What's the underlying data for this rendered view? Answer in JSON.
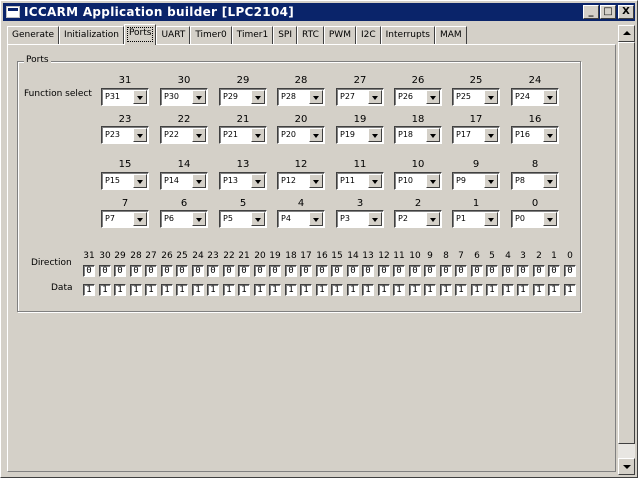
{
  "window": {
    "title": "ICCARM Application builder [LPC2104]",
    "controls": {
      "minimize": "_",
      "maximize": "□",
      "close": "X"
    }
  },
  "tabs": [
    "Generate",
    "Initialization",
    "Ports",
    "UART",
    "Timer0",
    "Timer1",
    "SPI",
    "RTC",
    "PWM",
    "I2C",
    "Interrupts",
    "MAM"
  ],
  "active_tab": "Ports",
  "ports_group": {
    "caption": "Ports",
    "function_select_label": "Function select",
    "rows": [
      {
        "ports": [
          "31",
          "30",
          "29",
          "28",
          "27",
          "26",
          "25",
          "24"
        ],
        "values": [
          "P31",
          "P30",
          "P29",
          "P28",
          "P27",
          "P26",
          "P25",
          "P24"
        ]
      },
      {
        "ports": [
          "23",
          "22",
          "21",
          "20",
          "19",
          "18",
          "17",
          "16"
        ],
        "values": [
          "P23",
          "P22",
          "P21",
          "P20",
          "P19",
          "P18",
          "P17",
          "P16"
        ]
      },
      {
        "ports": [
          "15",
          "14",
          "13",
          "12",
          "11",
          "10",
          "9",
          "8"
        ],
        "values": [
          "P15",
          "P14",
          "P13",
          "P12",
          "P11",
          "P10",
          "P9",
          "P8"
        ]
      },
      {
        "ports": [
          "7",
          "6",
          "5",
          "4",
          "3",
          "2",
          "1",
          "0"
        ],
        "values": [
          "P7",
          "P6",
          "P5",
          "P4",
          "P3",
          "P2",
          "P1",
          "P0"
        ]
      }
    ],
    "direction_label": "Direction",
    "data_label": "Data",
    "bit_numbers": [
      "31",
      "30",
      "29",
      "28",
      "27",
      "26",
      "25",
      "24",
      "23",
      "22",
      "21",
      "20",
      "19",
      "18",
      "17",
      "16",
      "15",
      "14",
      "13",
      "12",
      "11",
      "10",
      "9",
      "8",
      "7",
      "6",
      "5",
      "4",
      "3",
      "2",
      "1",
      "0"
    ],
    "direction_values": [
      "0",
      "0",
      "0",
      "0",
      "0",
      "0",
      "0",
      "0",
      "0",
      "0",
      "0",
      "0",
      "0",
      "0",
      "0",
      "0",
      "0",
      "0",
      "0",
      "0",
      "0",
      "0",
      "0",
      "0",
      "0",
      "0",
      "0",
      "0",
      "0",
      "0",
      "0",
      "0"
    ],
    "data_values": [
      "1",
      "1",
      "1",
      "1",
      "1",
      "1",
      "1",
      "1",
      "1",
      "1",
      "1",
      "1",
      "1",
      "1",
      "1",
      "1",
      "1",
      "1",
      "1",
      "1",
      "1",
      "1",
      "1",
      "1",
      "1",
      "1",
      "1",
      "1",
      "1",
      "1",
      "1",
      "1"
    ]
  }
}
